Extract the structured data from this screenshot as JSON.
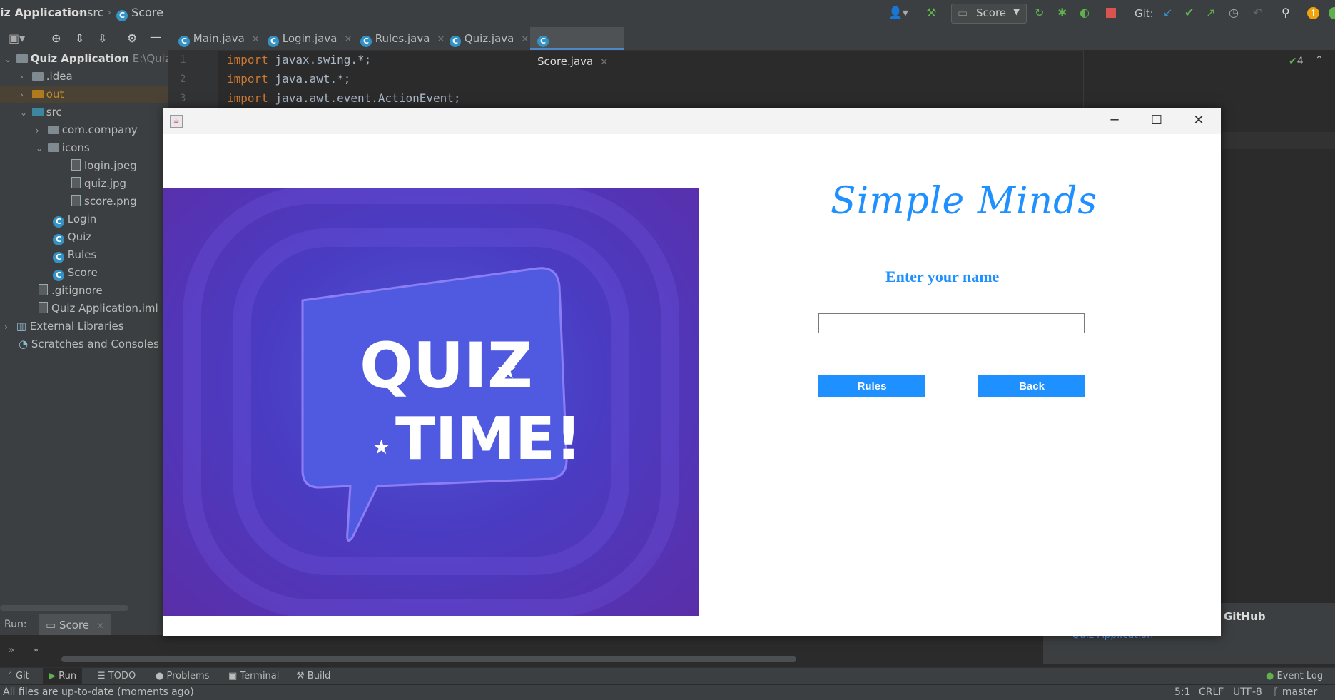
{
  "titlebar": {
    "project": "iz Application",
    "folder": "src",
    "file": "Score",
    "run_config": "Score",
    "git_label": "Git:"
  },
  "tabs": [
    {
      "label": "Main.java"
    },
    {
      "label": "Login.java"
    },
    {
      "label": "Rules.java"
    },
    {
      "label": "Quiz.java"
    },
    {
      "label": "Score.java"
    }
  ],
  "project": {
    "root": "Quiz Application",
    "root_path": "E:\\Quiz A",
    "items": {
      "idea": ".idea",
      "out": "out",
      "src": "src",
      "com_company": "com.company",
      "icons": "icons",
      "login_jpeg": "login.jpeg",
      "quiz_jpg": "quiz.jpg",
      "score_png": "score.png",
      "login": "Login",
      "quiz": "Quiz",
      "rules": "Rules",
      "score": "Score",
      "gitignore": ".gitignore",
      "iml": "Quiz Application.iml",
      "external": "External Libraries",
      "scratches": "Scratches and Consoles"
    }
  },
  "editor": {
    "lines": [
      {
        "num": "1",
        "kw": "import",
        "rest": " javax.swing.*;"
      },
      {
        "num": "2",
        "kw": "import",
        "rest": " java.awt.*;"
      },
      {
        "num": "3",
        "kw": "import",
        "rest": " java.awt.event.ActionEvent;"
      }
    ],
    "check_count": "4"
  },
  "run": {
    "label": "Run:",
    "tab": "Score",
    "github_title": "GitHub",
    "github_link": "Quiz-Application"
  },
  "toolwindows": {
    "git": "Git",
    "run": "Run",
    "todo": "TODO",
    "problems": "Problems",
    "terminal": "Terminal",
    "build": "Build",
    "event_log": "Event Log"
  },
  "status": {
    "message": "All files are up-to-date (moments ago)",
    "position": "5:1",
    "line_sep": "CRLF",
    "encoding": "UTF-8",
    "branch": "master"
  },
  "swing": {
    "app_name": "Simple Minds",
    "prompt": "Enter your name",
    "name_value": "",
    "rules_button": "Rules",
    "back_button": "Back",
    "image": {
      "line1": "QUIZ",
      "line2": "TIME!"
    }
  }
}
